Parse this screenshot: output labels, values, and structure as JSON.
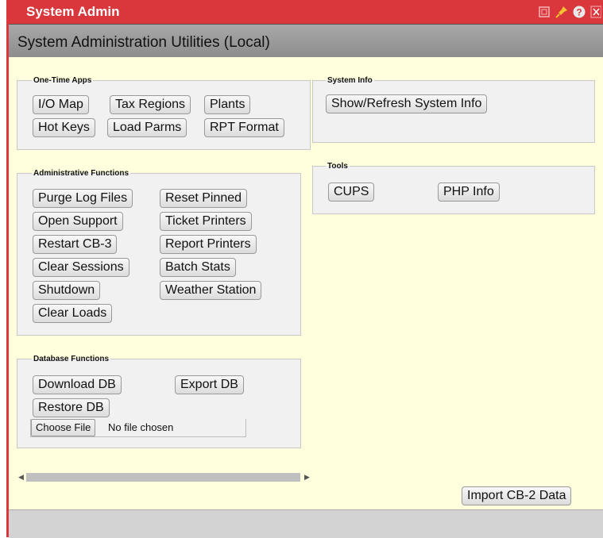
{
  "window": {
    "title": "System Admin"
  },
  "titlebar_icons": [
    "restore-icon",
    "pin-icon",
    "help-icon",
    "close-icon"
  ],
  "subheader": {
    "title": "System Administration Utilities (Local)"
  },
  "one_time_apps": {
    "legend": "One-Time Apps",
    "buttons": [
      "I/O Map",
      "Tax Regions",
      "Plants",
      "Hot Keys",
      "Load Parms",
      "RPT Format"
    ]
  },
  "system_info": {
    "legend": "System Info",
    "buttons": [
      "Show/Refresh System Info"
    ]
  },
  "tools": {
    "legend": "Tools",
    "buttons": [
      "CUPS",
      "PHP Info"
    ]
  },
  "admin_functions": {
    "legend": "Administrative Functions",
    "left_buttons": [
      "Purge Log Files",
      "Open Support",
      "Restart CB-3",
      "Clear Sessions",
      "Shutdown",
      "Clear Loads"
    ],
    "right_buttons": [
      "Reset Pinned",
      "Ticket Printers",
      "Report Printers",
      "Batch Stats",
      "Weather Station"
    ]
  },
  "database_functions": {
    "legend": "Database Functions",
    "buttons": [
      "Download DB",
      "Export DB",
      "Restore DB"
    ],
    "file_button": "Choose File",
    "file_status": "No file chosen"
  },
  "import_button": "Import CB-2 Data",
  "colors": {
    "titlebar": "#d9373c",
    "content_bg": "#ffffdd",
    "group_bg": "#f1f1f1"
  }
}
